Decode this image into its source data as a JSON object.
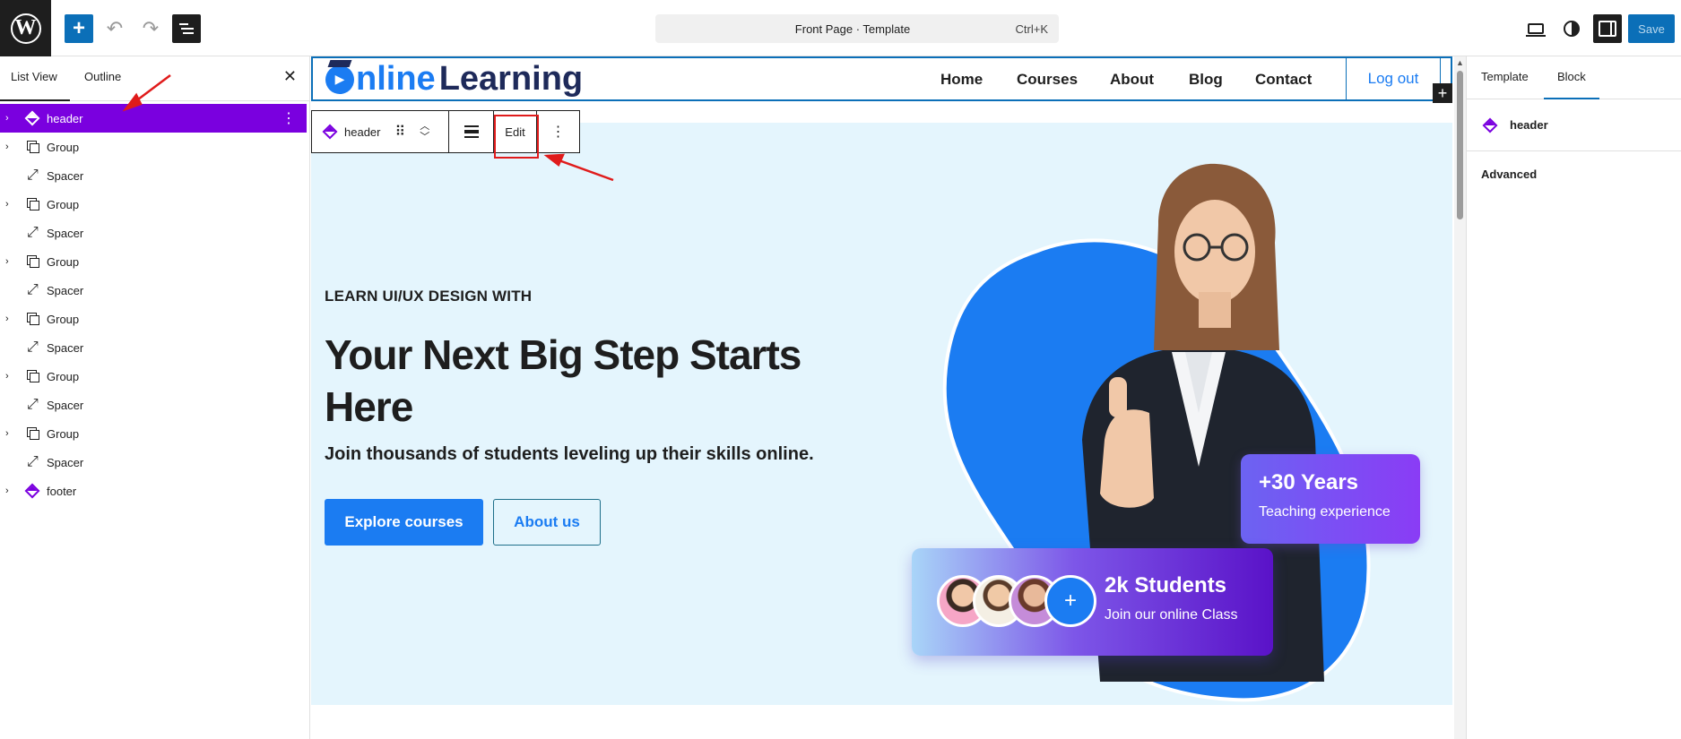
{
  "topbar": {
    "wp_logo": "W",
    "add_icon": "+",
    "undo_icon": "↶",
    "redo_icon": "↷",
    "document_title": "Front Page · Template",
    "shortcut": "Ctrl+K",
    "save_label": "Save"
  },
  "left_panel": {
    "tabs": [
      "List View",
      "Outline"
    ],
    "close_icon": "✕",
    "items": [
      {
        "label": "header",
        "type": "template-part",
        "expandable": true,
        "selected": true
      },
      {
        "label": "Group",
        "type": "group",
        "expandable": true
      },
      {
        "label": "Spacer",
        "type": "spacer",
        "expandable": false
      },
      {
        "label": "Group",
        "type": "group",
        "expandable": true
      },
      {
        "label": "Spacer",
        "type": "spacer",
        "expandable": false
      },
      {
        "label": "Group",
        "type": "group",
        "expandable": true
      },
      {
        "label": "Spacer",
        "type": "spacer",
        "expandable": false
      },
      {
        "label": "Group",
        "type": "group",
        "expandable": true
      },
      {
        "label": "Spacer",
        "type": "spacer",
        "expandable": false
      },
      {
        "label": "Group",
        "type": "group",
        "expandable": true
      },
      {
        "label": "Spacer",
        "type": "spacer",
        "expandable": false
      },
      {
        "label": "Group",
        "type": "group",
        "expandable": true
      },
      {
        "label": "Spacer",
        "type": "spacer",
        "expandable": false
      },
      {
        "label": "footer",
        "type": "template-part",
        "expandable": true
      }
    ]
  },
  "site_header": {
    "logo_part1": "nline",
    "logo_part2": "Learning",
    "logo_mark": "▶",
    "nav": [
      "Home",
      "Courses",
      "About",
      "Blog",
      "Contact"
    ],
    "logout": "Log out",
    "insert_icon": "+"
  },
  "block_toolbar": {
    "block_name": "header",
    "drag_icon": "⠿",
    "move_up": "︿",
    "move_down": "﹀",
    "edit_label": "Edit",
    "more_icon": "⋮"
  },
  "hero": {
    "kicker": "LEARN UI/UX DESIGN WITH",
    "title": "Your Next Big Step Starts Here",
    "subtitle": "Join thousands of students leveling up their skills online.",
    "primary_button": "Explore courses",
    "secondary_button": "About us",
    "years_card": {
      "big": "+30 Years",
      "small": "Teaching experience"
    },
    "students_card": {
      "big": "2k Students",
      "small": "Join our online Class",
      "plus": "+"
    }
  },
  "right_panel": {
    "tabs": [
      "Template",
      "Block"
    ],
    "block_name": "header",
    "advanced_label": "Advanced"
  },
  "colors": {
    "accent": "#0b6fb8",
    "selection": "#7a00df",
    "brand_blue": "#1b7cf2",
    "hero_bg": "#e4f5fd",
    "annotation_red": "#e01b1b"
  }
}
